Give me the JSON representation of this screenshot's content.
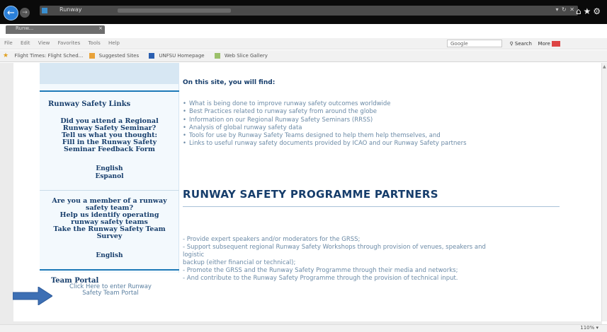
{
  "browser": {
    "address_text": "Runway",
    "tab_title": "Runw...",
    "menu": [
      "File",
      "Edit",
      "View",
      "Favorites",
      "Tools",
      "Help"
    ],
    "search_placeholder": "Google",
    "search_label": "Search",
    "more_label": "More",
    "favorites": [
      "Flight Times: Flight Sched...",
      "Suggested Sites",
      "UNFSU Homepage",
      "Web Slice Gallery"
    ],
    "zoom": "110%"
  },
  "sidebar": {
    "runway_safety_links_heading": "Runway Safety Links",
    "seminar_prompt": [
      "Did you attend a Regional",
      "Runway Safety Seminar?",
      "Tell us what you thought:",
      "Fill in the Runway Safety",
      "Seminar Feedback Form"
    ],
    "seminar_languages": [
      "English",
      "Espanol"
    ],
    "team_prompt": [
      "Are you a member of a runway",
      "safety team?",
      "Help us identify operating",
      "runway safety teams",
      "Take the Runway Safety Team",
      "Survey"
    ],
    "team_language": "English",
    "team_portal_heading": "Team Portal",
    "team_portal_link": [
      "Click Here to enter Runway",
      "Safety Team Portal"
    ]
  },
  "main": {
    "find_heading": "On this site, you will find:",
    "bullets": [
      "What is being done to improve runway safety outcomes worldwide",
      "Best Practices related to runway safety from around the globe",
      "Information on our Regional Runway Safety Seminars (RRSS)",
      "Analysis of global runway safety data",
      "Tools for use by Runway Safety Teams designed to help them help themselves, and",
      "Links to useful runway safety documents provided by ICAO and our Runway Safety partners"
    ],
    "partners_heading": "RUNWAY SAFETY PROGRAMME PARTNERS",
    "partner_lines": [
      "- Provide expert speakers and/or moderators for the GRSS;",
      "- Support subsequent regional Runway Safety Workshops through provision of venues, speakers and",
      "logistic",
      "  backup (either financial or technical);",
      "- Promote the GRSS and the Runway Safety Programme through their media and networks;",
      "- And contribute to the Runway Safety Programme through the provision of technical input."
    ]
  },
  "colors": {
    "arrow": "#3d6fb4",
    "heading": "#163d6b",
    "body_text": "#6b8aa6",
    "rule": "#1e7ab8"
  }
}
